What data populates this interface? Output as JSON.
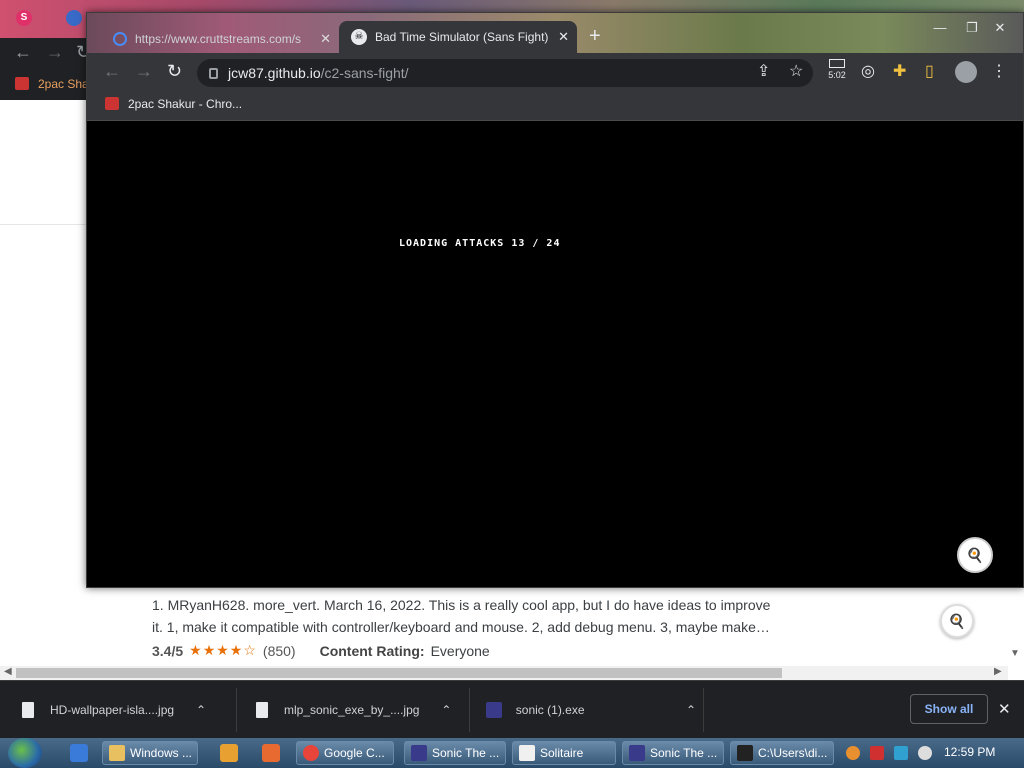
{
  "background_window": {
    "bookmark": "2pac Sha",
    "review": {
      "text": "1. MRyanH628. more_vert. March 16, 2022. This is a really cool app, but I do have ideas to improve it. 1, make it compatible with controller/keyboard and mouse. 2, add debug menu. 3, maybe make…",
      "score": "3.4/5",
      "stars": "★★★★☆",
      "count": "(850)",
      "content_rating_label": "Content Rating:",
      "content_rating_value": "Everyone"
    }
  },
  "browser": {
    "tabs": [
      {
        "title": "https://www.cruttstreams.com/s",
        "active": false
      },
      {
        "title": "Bad Time Simulator (Sans Fight)",
        "active": true
      }
    ],
    "url_host": "jcw87.github.io",
    "url_path": "/c2-sans-fight/",
    "extension_badge": "5:02",
    "bookmarks": [
      {
        "label": "2pac Shakur - Chro..."
      }
    ]
  },
  "game": {
    "loading_text": "LOADING ATTACKS 13 / 24"
  },
  "downloads": {
    "items": [
      {
        "name": "HD-wallpaper-isla....jpg"
      },
      {
        "name": "mlp_sonic_exe_by_....jpg"
      },
      {
        "name": "sonic (1).exe"
      }
    ],
    "show_all": "Show all"
  },
  "taskbar": {
    "tasks": [
      {
        "label": "Windows ..."
      },
      {
        "label": "Google C..."
      },
      {
        "label": "Sonic The ..."
      },
      {
        "label": "Solitaire"
      },
      {
        "label": "Sonic The ..."
      },
      {
        "label": "C:\\Users\\di..."
      }
    ],
    "clock": "12:59 PM"
  }
}
